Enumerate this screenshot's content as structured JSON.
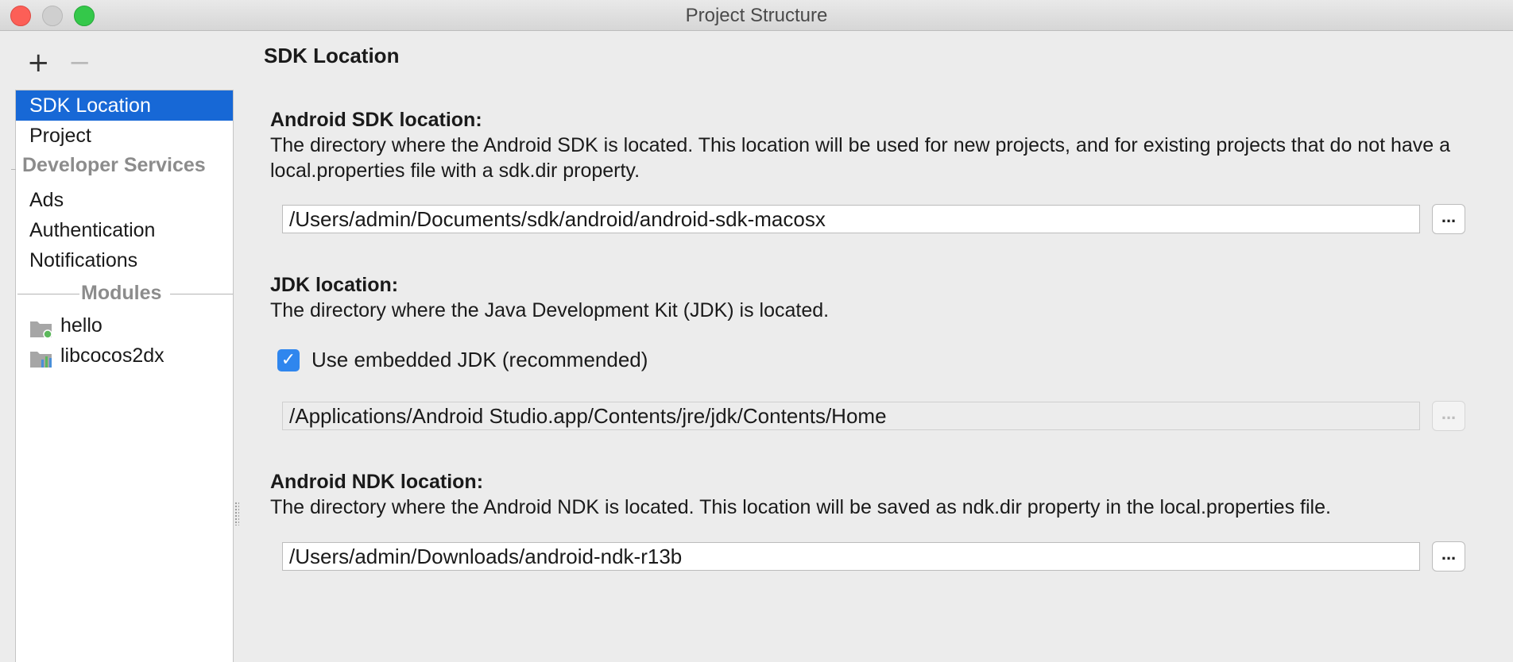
{
  "window": {
    "title": "Project Structure"
  },
  "toolbar": {
    "add_label": "+",
    "remove_label": "−"
  },
  "sidebar": {
    "items": [
      {
        "label": "SDK Location",
        "selected": true
      },
      {
        "label": "Project"
      }
    ],
    "developer_services_header": "Developer Services",
    "service_items": [
      {
        "label": "Ads"
      },
      {
        "label": "Authentication"
      },
      {
        "label": "Notifications"
      }
    ],
    "modules_header": "Modules",
    "modules": [
      {
        "label": "hello",
        "icon": "app-module-icon"
      },
      {
        "label": "libcocos2dx",
        "icon": "library-module-icon"
      }
    ]
  },
  "main": {
    "title": "SDK Location",
    "android_sdk": {
      "heading": "Android SDK location:",
      "description": "The directory where the Android SDK is located. This location will be used for new projects, and for existing projects that do not have a local.properties file with a sdk.dir property.",
      "path": "/Users/admin/Documents/sdk/android/android-sdk-macosx",
      "browse_label": "..."
    },
    "jdk": {
      "heading": "JDK location:",
      "description": "The directory where the Java Development Kit (JDK) is located.",
      "embedded_checkbox_label": "Use embedded JDK (recommended)",
      "embedded_checked": true,
      "path": "/Applications/Android Studio.app/Contents/jre/jdk/Contents/Home",
      "browse_label": "..."
    },
    "android_ndk": {
      "heading": "Android NDK location:",
      "description": "The directory where the Android NDK is located. This location will be saved as ndk.dir property in the local.properties file.",
      "path": "/Users/admin/Downloads/android-ndk-r13b",
      "browse_label": "..."
    }
  },
  "colors": {
    "selection": "#1768d6",
    "checkbox": "#2f86ee"
  }
}
